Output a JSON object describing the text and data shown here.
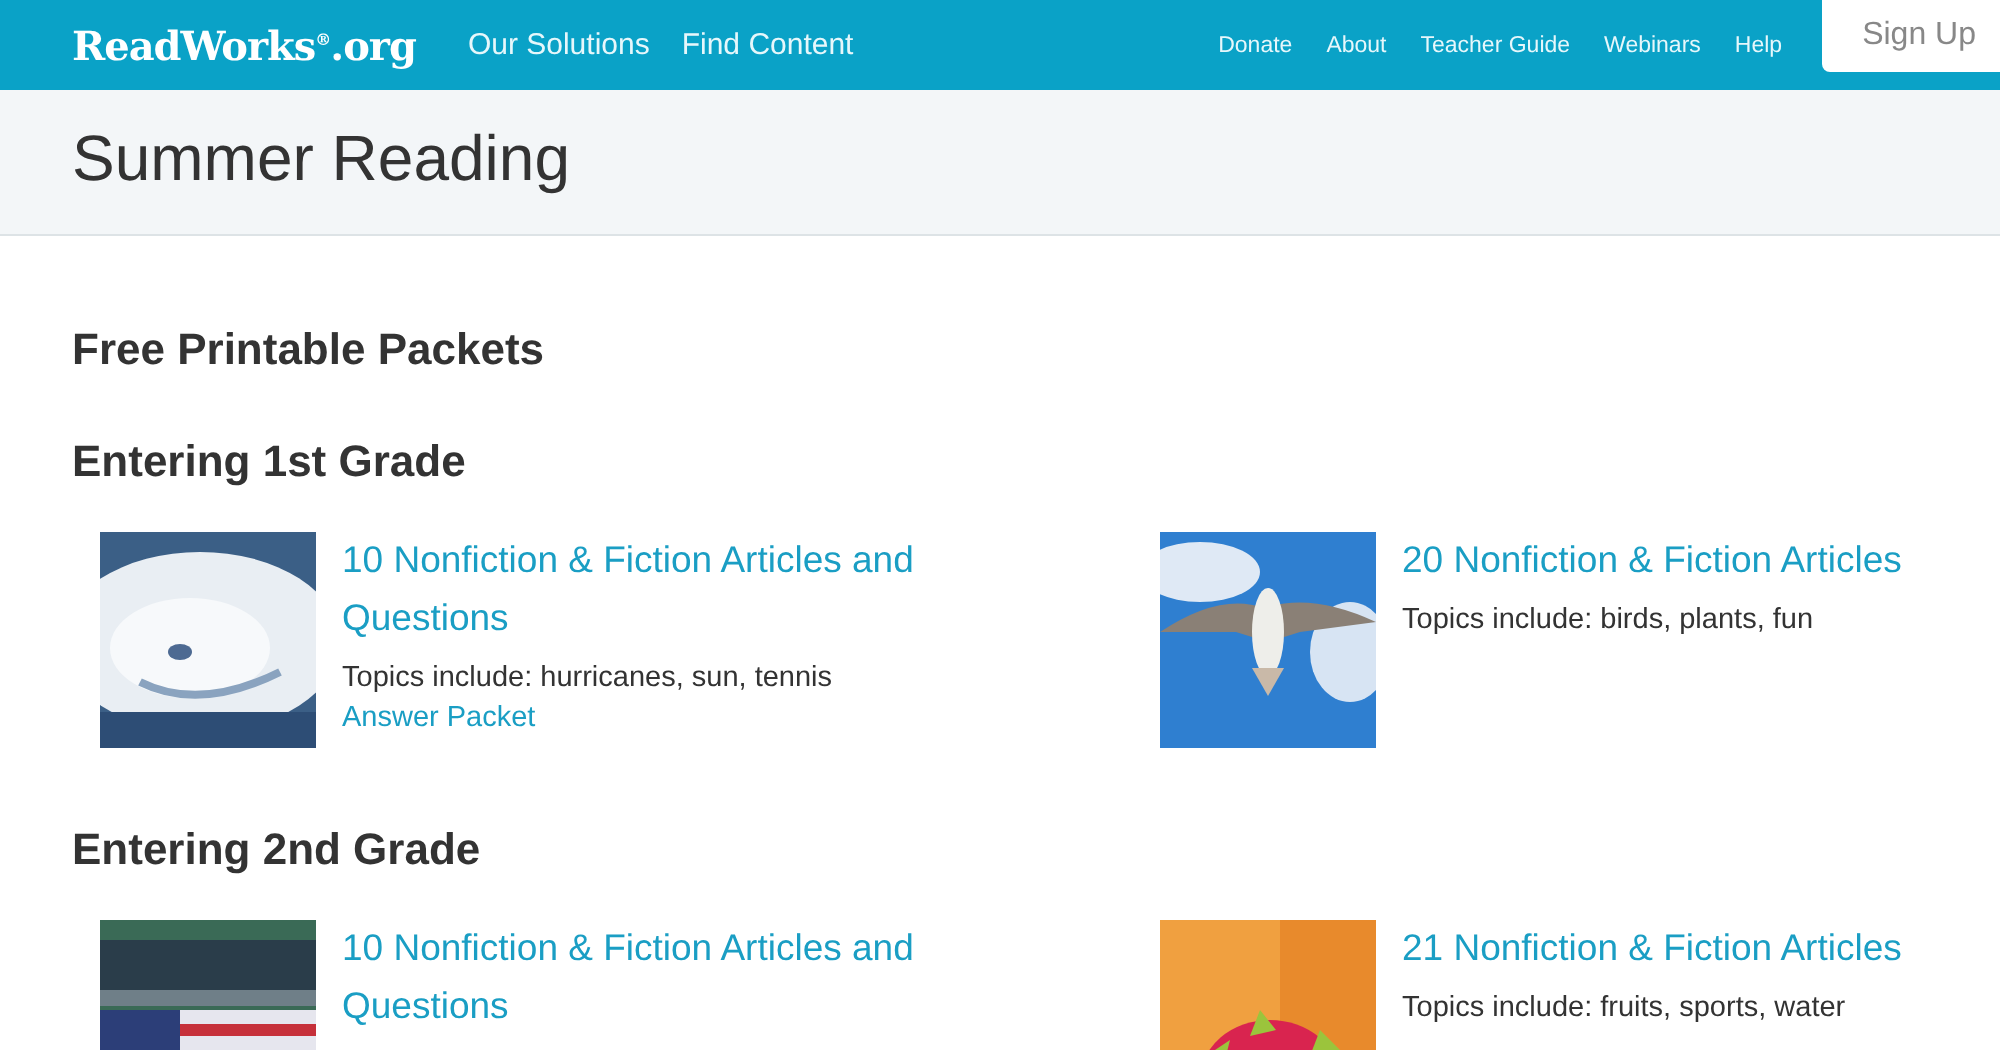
{
  "header": {
    "logo": "ReadWorks$^{®}$.org",
    "nav_main": [
      "Our Solutions",
      "Find Content"
    ],
    "nav_secondary": [
      "Donate",
      "About",
      "Teacher Guide",
      "Webinars",
      "Help"
    ],
    "signup_button": "Sign Up"
  },
  "page_title": "Summer Reading",
  "section_heading": "Free Printable Packets",
  "grades": [
    {
      "heading": "Entering 1st Grade",
      "packets": [
        {
          "title": "10 Nonfiction & Fiction Articles and Questions",
          "topics": "Topics include: hurricanes, sun, tennis",
          "answer_link": "Answer Packet"
        },
        {
          "title": "20 Nonfiction & Fiction Articles",
          "topics": "Topics include: birds, plants, fun"
        }
      ]
    },
    {
      "heading": "Entering 2nd Grade",
      "packets": [
        {
          "title": "10 Nonfiction & Fiction Articles and Questions"
        },
        {
          "title": "21 Nonfiction & Fiction Articles",
          "topics": "Topics include: fruits, sports, water"
        }
      ]
    }
  ]
}
